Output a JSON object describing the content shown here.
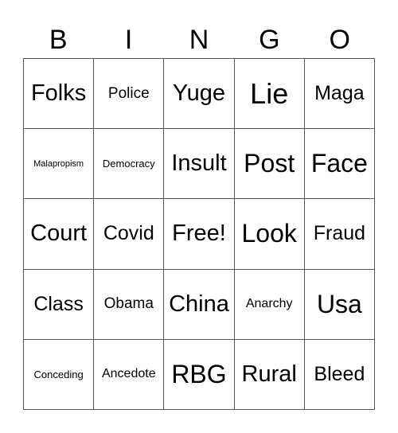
{
  "header": {
    "letters": [
      "B",
      "I",
      "N",
      "G",
      "O"
    ]
  },
  "card": {
    "rows": [
      [
        "Folks",
        "Police",
        "Yuge",
        "Lie",
        "Maga"
      ],
      [
        "Malapropism",
        "Democracy",
        "Insult",
        "Post",
        "Face"
      ],
      [
        "Court",
        "Covid",
        "Free!",
        "Look",
        "Fraud"
      ],
      [
        "Class",
        "Obama",
        "China",
        "Anarchy",
        "Usa"
      ],
      [
        "Conceding",
        "Ancedote",
        "RBG",
        "Rural",
        "Bleed"
      ]
    ]
  }
}
